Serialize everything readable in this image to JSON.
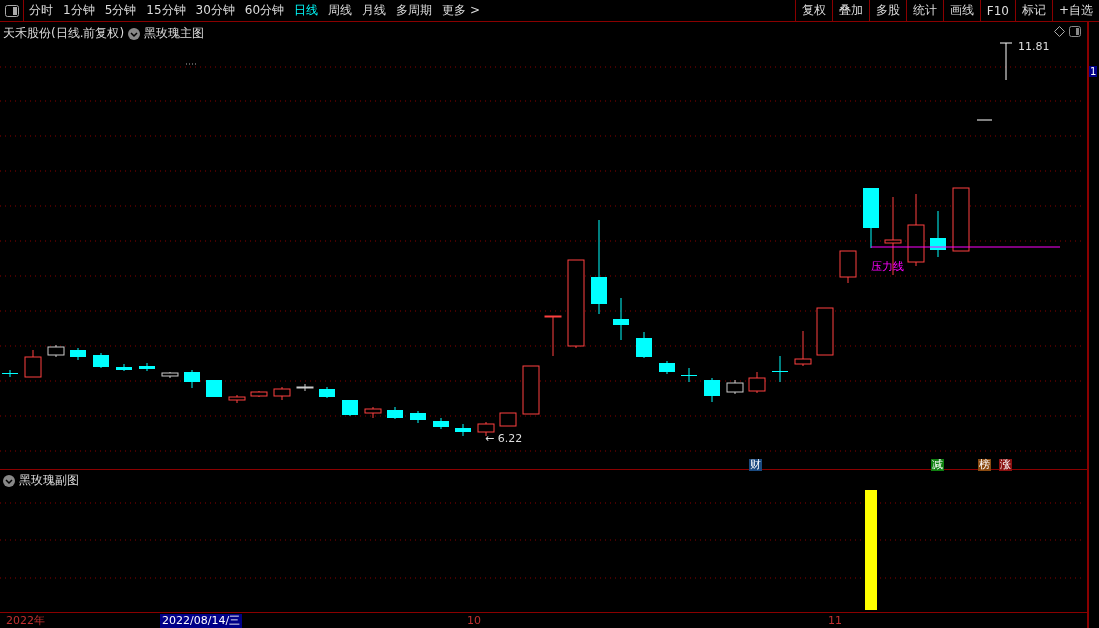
{
  "toolbar": {
    "periods": [
      {
        "label": "分时",
        "selected": false
      },
      {
        "label": "1分钟",
        "selected": false
      },
      {
        "label": "5分钟",
        "selected": false
      },
      {
        "label": "15分钟",
        "selected": false
      },
      {
        "label": "30分钟",
        "selected": false
      },
      {
        "label": "60分钟",
        "selected": false
      },
      {
        "label": "日线",
        "selected": true
      },
      {
        "label": "周线",
        "selected": false
      },
      {
        "label": "月线",
        "selected": false
      },
      {
        "label": "多周期",
        "selected": false
      },
      {
        "label": "更多 >",
        "selected": false
      }
    ],
    "actions": [
      "复权",
      "叠加",
      "多股",
      "统计",
      "画线",
      "F10",
      "标记",
      "+自选"
    ]
  },
  "main_chart": {
    "title": "天禾股份(日线.前复权)",
    "indicator": "黑玫瑰主图",
    "high_label": "11.81",
    "low_label": "← 6.22",
    "line_label": "压力线",
    "markers": [
      {
        "label": "财",
        "color": "#1a4a80"
      },
      {
        "label": "减",
        "color": "#108010"
      },
      {
        "label": "榜",
        "color": "#8a4a10"
      },
      {
        "label": "涨",
        "color": "#8a1010"
      }
    ]
  },
  "price_axis": {
    "current": "1"
  },
  "sub_chart": {
    "indicator": "黑玫瑰副图"
  },
  "date_axis": {
    "labels": [
      {
        "label": "2022年",
        "selected": false
      },
      {
        "label": "2022/08/14/三",
        "selected": true
      },
      {
        "label": "10",
        "selected": false
      },
      {
        "label": "11",
        "selected": false
      }
    ]
  }
}
